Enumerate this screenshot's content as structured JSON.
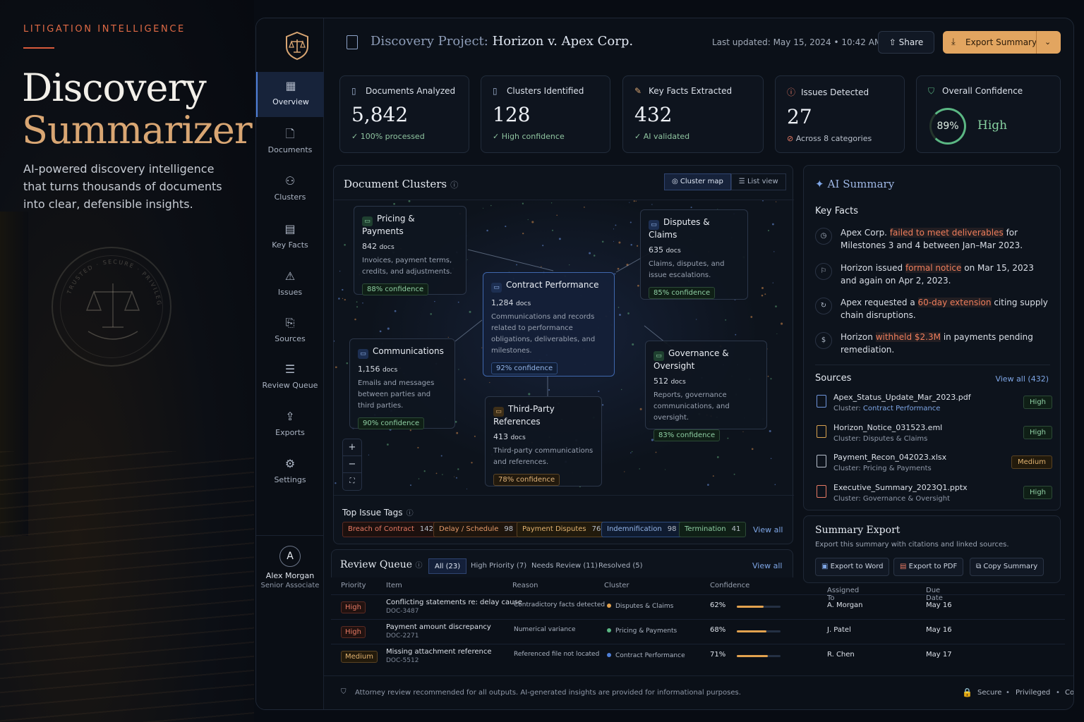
{
  "hero": {
    "kicker": "LITIGATION INTELLIGENCE",
    "title_line1": "Discovery",
    "title_line2": "Summarizer",
    "description": "AI-powered discovery intelligence that turns thousands of documents into clear, defensible insights.",
    "seal_text": "TRUSTED · SECURE · PRIVILEGED"
  },
  "nav": {
    "items": [
      {
        "label": "Overview",
        "icon": "grid-icon"
      },
      {
        "label": "Documents",
        "icon": "document-icon"
      },
      {
        "label": "Clusters",
        "icon": "clusters-icon"
      },
      {
        "label": "Key Facts",
        "icon": "key-facts-icon"
      },
      {
        "label": "Issues",
        "icon": "issues-icon"
      },
      {
        "label": "Sources",
        "icon": "sources-icon"
      },
      {
        "label": "Review Queue",
        "icon": "review-queue-icon"
      },
      {
        "label": "Exports",
        "icon": "export-icon"
      },
      {
        "label": "Settings",
        "icon": "gear-icon"
      }
    ],
    "active": "Overview"
  },
  "user": {
    "initial": "A",
    "name": "Alex Morgan",
    "role": "Senior Associate"
  },
  "header": {
    "project_prefix": "Discovery Project:",
    "project_name": "Horizon v. Apex Corp.",
    "updated": "Last updated: May 15, 2024  •  10:42 AM",
    "share": "Share",
    "export": "Export Summary"
  },
  "stats": [
    {
      "label": "Documents Analyzed",
      "value": "5,842",
      "sub": "100% processed"
    },
    {
      "label": "Clusters Identified",
      "value": "128",
      "sub": "High confidence"
    },
    {
      "label": "Key Facts Extracted",
      "value": "432",
      "sub": "AI validated"
    },
    {
      "label": "Issues Detected",
      "value": "27",
      "sub": "Across 8 categories"
    },
    {
      "label": "Overall Confidence",
      "value": "89%",
      "sub": "High",
      "fraction": 0.89
    }
  ],
  "clusters_panel": {
    "title": "Document Clusters",
    "view_map": "Cluster map",
    "view_list": "List view",
    "nodes": [
      {
        "name": "Pricing & Payments",
        "docs": "842",
        "docs_unit": "docs",
        "desc": "Invoices, payment terms, credits, and adjustments.",
        "confidence": "88% confidence"
      },
      {
        "name": "Disputes & Claims",
        "docs": "635",
        "docs_unit": "docs",
        "desc": "Claims, disputes, and issue escalations.",
        "confidence": "85% confidence"
      },
      {
        "name": "Contract Performance",
        "docs": "1,284",
        "docs_unit": "docs",
        "desc": "Communications and records related to performance obligations, deliverables, and milestones.",
        "confidence": "92% confidence"
      },
      {
        "name": "Communications",
        "docs": "1,156",
        "docs_unit": "docs",
        "desc": "Emails and messages between parties and third parties.",
        "confidence": "90% confidence"
      },
      {
        "name": "Governance & Oversight",
        "docs": "512",
        "docs_unit": "docs",
        "desc": "Reports, governance communications, and oversight.",
        "confidence": "83% confidence"
      },
      {
        "name": "Third-Party References",
        "docs": "413",
        "docs_unit": "docs",
        "desc": "Third-party communications and references.",
        "confidence": "78% confidence"
      }
    ],
    "zoom": {
      "in": "+",
      "out": "−",
      "fit": "⛶"
    },
    "tags_title": "Top Issue Tags",
    "tags": [
      {
        "label": "Breach of Contract",
        "count": "142"
      },
      {
        "label": "Delay / Schedule",
        "count": "98"
      },
      {
        "label": "Payment Disputes",
        "count": "76"
      },
      {
        "label": "Indemnification",
        "count": "98"
      },
      {
        "label": "Termination",
        "count": "41"
      }
    ],
    "view_all": "View all"
  },
  "review": {
    "title": "Review Queue",
    "tabs": [
      "All (23)",
      "High Priority (7)",
      "Needs Review (11)",
      "Resolved (5)"
    ],
    "view_all": "View all",
    "columns": [
      "Priority",
      "Item",
      "Reason",
      "Cluster",
      "Confidence",
      "Assigned To",
      "Due Date"
    ],
    "rows": [
      {
        "priority": "High",
        "item": "Conflicting statements re: delay cause",
        "id": "DOC-3487",
        "reason": "Contradictory facts detected",
        "cluster": "Disputes & Claims",
        "confidence": "62%",
        "conf_value": 0.62,
        "assigned": "A. Morgan",
        "due": "May 16"
      },
      {
        "priority": "High",
        "item": "Payment amount discrepancy",
        "id": "DOC-2271",
        "reason": "Numerical variance",
        "cluster": "Pricing & Payments",
        "confidence": "68%",
        "conf_value": 0.68,
        "assigned": "J. Patel",
        "due": "May 16"
      },
      {
        "priority": "Medium",
        "item": "Missing attachment reference",
        "id": "DOC-5512",
        "reason": "Referenced file not located",
        "cluster": "Contract Performance",
        "confidence": "71%",
        "conf_value": 0.71,
        "assigned": "R. Chen",
        "due": "May 17"
      }
    ]
  },
  "ai_summary": {
    "title": "AI Summary",
    "key_facts_title": "Key Facts",
    "facts": [
      {
        "pre": "Apex Corp. ",
        "hl": "failed to meet deliverables",
        "post": " for Milestones 3 and 4 between Jan–Mar 2023."
      },
      {
        "pre": "Horizon issued ",
        "hl": "formal notice",
        "post": " on Mar 15, 2023 and again on Apr 2, 2023."
      },
      {
        "pre": "Apex requested a ",
        "hl": "60-day extension",
        "post": " citing supply chain disruptions."
      },
      {
        "pre": "Horizon ",
        "hl": "withheld $2.3M",
        "post": " in payments pending remediation."
      }
    ],
    "sources_title": "Sources",
    "sources_view_all": "View all (432)",
    "sources": [
      {
        "file": "Apex_Status_Update_Mar_2023.pdf",
        "cluster_label": "Cluster:",
        "cluster": "Contract Performance",
        "level": "High"
      },
      {
        "file": "Horizon_Notice_031523.eml",
        "cluster_label": "Cluster:",
        "cluster": "Disputes & Claims",
        "level": "High"
      },
      {
        "file": "Payment_Recon_042023.xlsx",
        "cluster_label": "Cluster:",
        "cluster": "Pricing & Payments",
        "level": "Medium"
      },
      {
        "file": "Executive_Summary_2023Q1.pptx",
        "cluster_label": "Cluster:",
        "cluster": "Governance & Oversight",
        "level": "High"
      }
    ]
  },
  "summary_export": {
    "title": "Summary Export",
    "desc": "Export this summary with citations and linked sources.",
    "word": "Export to Word",
    "pdf": "Export to PDF",
    "copy": "Copy Summary"
  },
  "footer": {
    "notice": "Attorney review recommended for all outputs. AI-generated insights are provided for informational purposes.",
    "secure": "Secure",
    "privileged": "Privileged",
    "confidential": "Confidential"
  },
  "colors": {
    "accent": "#e2a560",
    "primary": "#4f7fd8",
    "success": "#5bb783",
    "danger": "#e87a64"
  }
}
